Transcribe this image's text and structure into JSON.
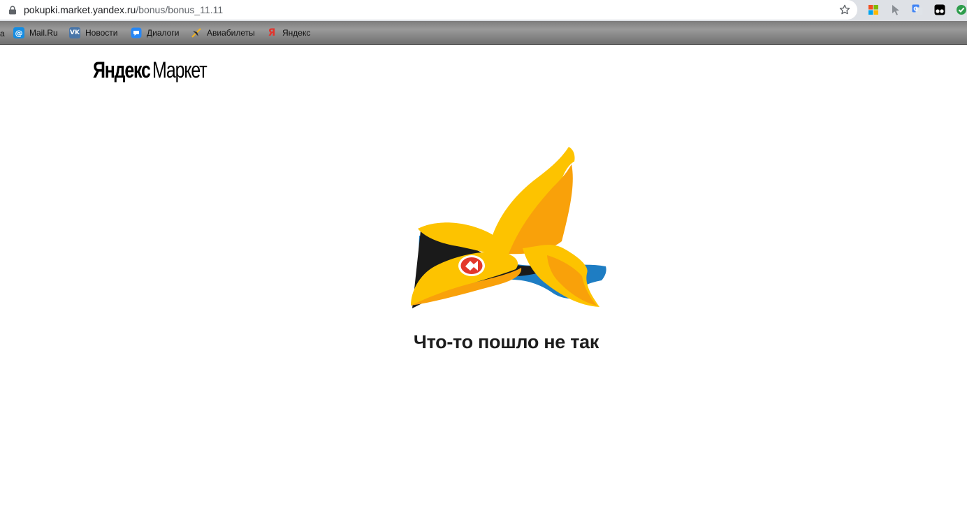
{
  "browser": {
    "url_host": "pokupki.market.yandex.ru",
    "url_path": "/bonus/bonus_11.11",
    "bookmarks_edge_text": "a",
    "bookmarks": [
      {
        "label": "Mail.Ru",
        "icon": "mailru-at-icon"
      },
      {
        "label": "Новости",
        "icon": "vk-icon"
      },
      {
        "label": "Диалоги",
        "icon": "chat-bubble-icon"
      },
      {
        "label": "Авиабилеты",
        "icon": "plane-icon"
      },
      {
        "label": "Яндекс",
        "icon": "yandex-icon"
      }
    ],
    "extensions": [
      "windows-extension-icon",
      "cursor-extension-icon",
      "google-translate-icon",
      "tampermonkey-icon",
      "check-extension-icon"
    ]
  },
  "page": {
    "logo_brand": "Яндекс",
    "logo_product": "Маркет",
    "error_title": "Что-то пошло не так",
    "colors": {
      "banana_yellow": "#fdc300",
      "banana_orange": "#f9a10a",
      "shadow_blue": "#1e7dc3",
      "badge_red": "#e3382b"
    }
  }
}
